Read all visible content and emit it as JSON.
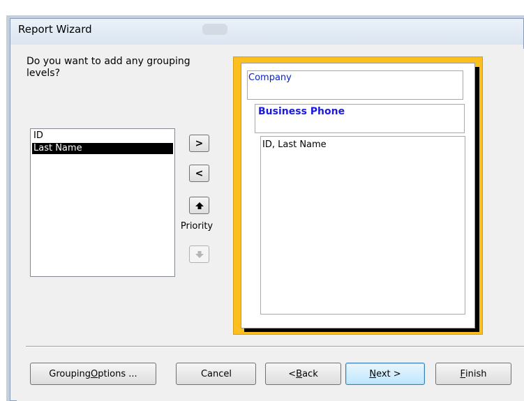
{
  "window": {
    "title": "Report Wizard"
  },
  "prompt": {
    "question": "Do you want to add any grouping levels?"
  },
  "fields": [
    {
      "label": "ID",
      "selected": false
    },
    {
      "label": "Last Name",
      "selected": true
    }
  ],
  "move_buttons": {
    "add": ">",
    "remove": "<",
    "priority_label": "Priority"
  },
  "preview": {
    "group_level_1": "Company",
    "group_level_2": "Business Phone",
    "detail_fields": "ID, Last Name"
  },
  "footer": {
    "grouping_options": {
      "pre": "Grouping ",
      "key": "O",
      "post": "ptions ..."
    },
    "cancel": {
      "label": "Cancel"
    },
    "back": {
      "pre": "< ",
      "key": "B",
      "post": "ack"
    },
    "next": {
      "pre": "",
      "key": "N",
      "post": "ext >"
    },
    "finish": {
      "pre": "",
      "key": "F",
      "post": "inish"
    }
  },
  "colors": {
    "preview_frame": "#fbbf1f",
    "group_text": "#1a1ae0",
    "selection": "#000000"
  }
}
